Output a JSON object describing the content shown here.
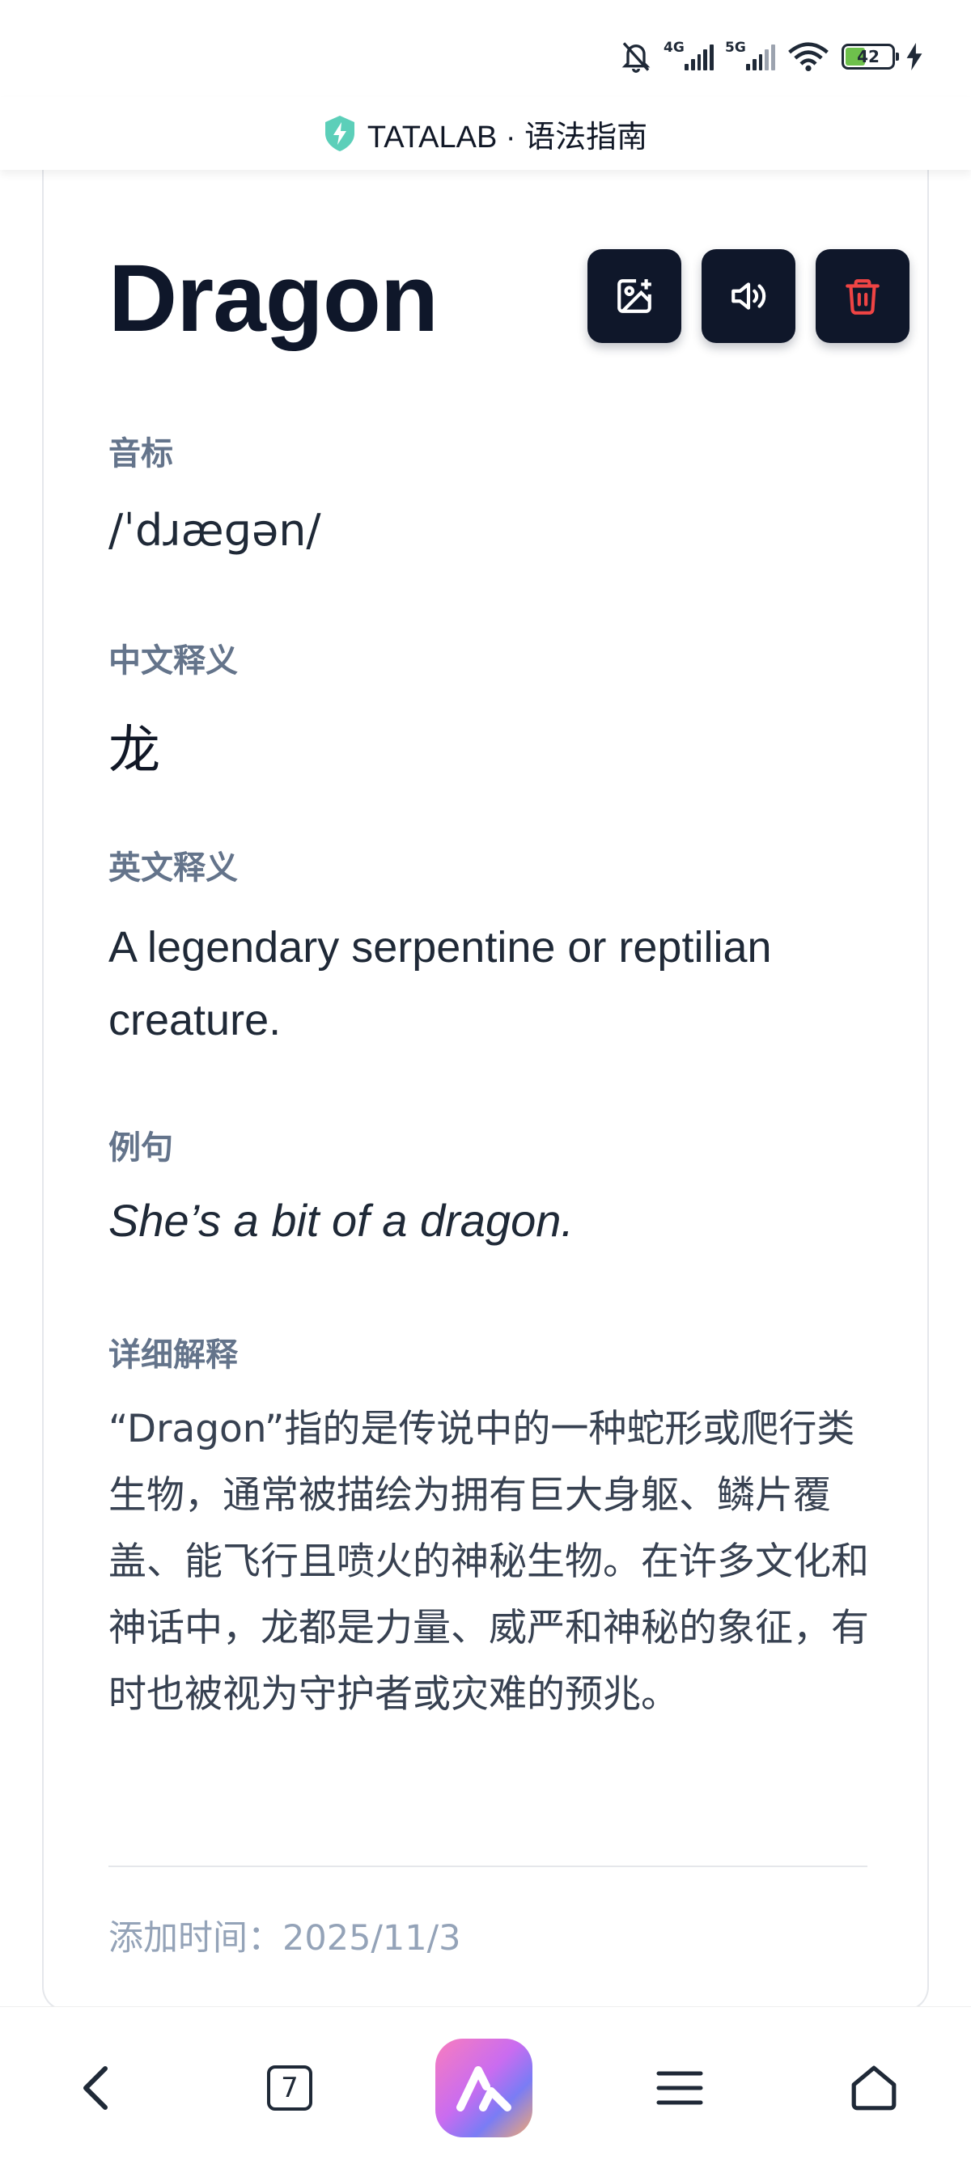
{
  "status": {
    "network1": "4G",
    "network2": "5G",
    "battery": "42"
  },
  "site": {
    "title": "TATALAB · 语法指南"
  },
  "word": {
    "text": "Dragon"
  },
  "sections": {
    "phonetic_label": "音标",
    "phonetic": "/ˈdɹæɡən/",
    "zh_label": "中文释义",
    "zh": "龙",
    "en_label": "英文释义",
    "en": "A legendary serpentine or reptilian creature.",
    "example_label": "例句",
    "example": "She’s a bit of a dragon.",
    "detail_label": "详细解释",
    "detail": "“Dragon”指的是传说中的一种蛇形或爬行类生物，通常被描绘为拥有巨大身躯、鳞片覆盖、能飞行且喷火的神秘生物。在许多文化和神话中，龙都是力量、威严和神秘的象征，有时也被视为守护者或灾难的预兆。"
  },
  "footer": {
    "added": "添加时间：2025/11/3"
  },
  "nav": {
    "tab_count": "7"
  },
  "colors": {
    "button_bg": "#0f172a",
    "delete_red": "#ef4444",
    "label_gray": "#64748b",
    "shield_teal": "#5ccfb9"
  },
  "icons": [
    "mute-bell-icon",
    "signal-4g-icon",
    "signal-5g-icon",
    "wifi-icon",
    "battery-icon",
    "charging-icon",
    "shield-bolt-icon",
    "add-image-icon",
    "speaker-icon",
    "trash-icon",
    "back-icon",
    "tabs-icon",
    "app-logo-icon",
    "menu-icon",
    "home-icon"
  ]
}
